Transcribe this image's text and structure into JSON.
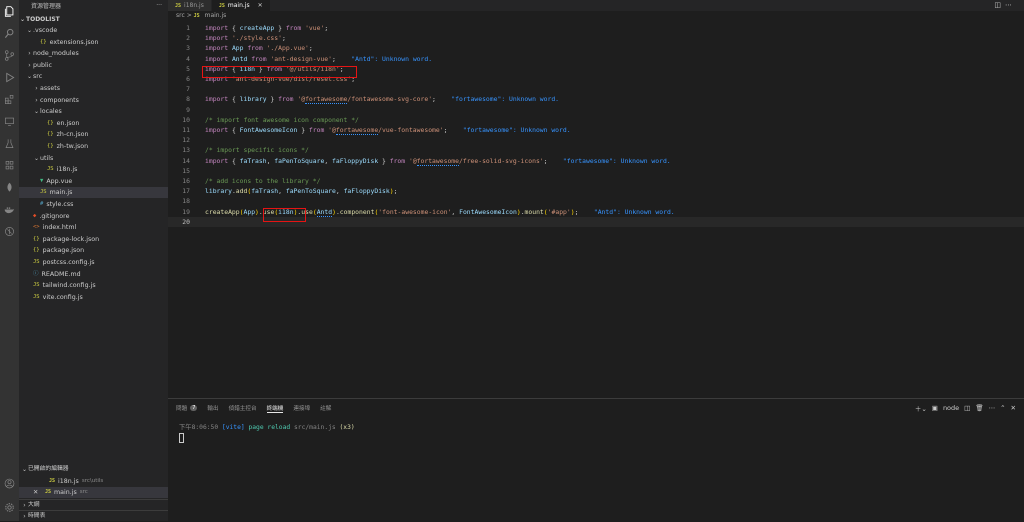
{
  "explorer": {
    "title": "資源管理器",
    "more": "···",
    "folder": "TODOLIST",
    "items": [
      {
        "label": ".vscode",
        "kind": "folder",
        "open": true,
        "depth": 1
      },
      {
        "label": "extensions.json",
        "kind": "json",
        "depth": 2
      },
      {
        "label": "node_modules",
        "kind": "folder",
        "open": false,
        "depth": 1
      },
      {
        "label": "public",
        "kind": "folder",
        "open": false,
        "depth": 1
      },
      {
        "label": "src",
        "kind": "folder",
        "open": true,
        "depth": 1
      },
      {
        "label": "assets",
        "kind": "folder",
        "open": false,
        "depth": 2
      },
      {
        "label": "components",
        "kind": "folder",
        "open": false,
        "depth": 2
      },
      {
        "label": "locales",
        "kind": "folder",
        "open": true,
        "depth": 2
      },
      {
        "label": "en.json",
        "kind": "json",
        "depth": 3
      },
      {
        "label": "zh-cn.json",
        "kind": "json",
        "depth": 3
      },
      {
        "label": "zh-tw.json",
        "kind": "json",
        "depth": 3
      },
      {
        "label": "utils",
        "kind": "folder",
        "open": true,
        "depth": 2
      },
      {
        "label": "i18n.js",
        "kind": "js",
        "depth": 3
      },
      {
        "label": "App.vue",
        "kind": "vue",
        "depth": 2
      },
      {
        "label": "main.js",
        "kind": "js",
        "depth": 2,
        "selected": true
      },
      {
        "label": "style.css",
        "kind": "css",
        "depth": 2
      },
      {
        "label": ".gitignore",
        "kind": "git",
        "depth": 1
      },
      {
        "label": "index.html",
        "kind": "html",
        "depth": 1
      },
      {
        "label": "package-lock.json",
        "kind": "json",
        "depth": 1
      },
      {
        "label": "package.json",
        "kind": "json",
        "depth": 1
      },
      {
        "label": "postcss.config.js",
        "kind": "js",
        "depth": 1
      },
      {
        "label": "README.md",
        "kind": "md",
        "depth": 1
      },
      {
        "label": "tailwind.config.js",
        "kind": "js",
        "depth": 1
      },
      {
        "label": "vite.config.js",
        "kind": "js",
        "depth": 1
      }
    ],
    "open_editors": {
      "title": "已開啟的編輯器",
      "files": [
        {
          "name": "i18n.js",
          "path": "src\\utils",
          "active": false
        },
        {
          "name": "main.js",
          "path": "src",
          "active": true
        }
      ]
    },
    "outline": "大綱",
    "timeline": "時間表"
  },
  "tabs": [
    {
      "label": "i18n.js",
      "active": false
    },
    {
      "label": "main.js",
      "active": true
    }
  ],
  "breadcrumb": {
    "folder": "src",
    "sep": ">",
    "file": "main.js"
  },
  "code_lines": [
    [
      [
        "k",
        "import"
      ],
      [
        "p",
        " { "
      ],
      [
        "v",
        "createApp"
      ],
      [
        "p",
        " } "
      ],
      [
        "k",
        "from"
      ],
      [
        "s",
        " 'vue'"
      ],
      [
        "p",
        ";"
      ]
    ],
    [
      [
        "k",
        "import"
      ],
      [
        "s",
        " './style.css'"
      ],
      [
        "p",
        ";"
      ]
    ],
    [
      [
        "k",
        "import"
      ],
      [
        "v",
        " App"
      ],
      [
        "k",
        " from"
      ],
      [
        "s",
        " './App.vue'"
      ],
      [
        "p",
        ";"
      ]
    ],
    [
      [
        "k",
        "import"
      ],
      [
        "v",
        " Antd"
      ],
      [
        "k",
        " from"
      ],
      [
        "s",
        " 'ant-design-vue'"
      ],
      [
        "p",
        ";"
      ],
      [
        "hint",
        "    \"Antd\": Unknown word."
      ]
    ],
    [
      [
        "k",
        "import"
      ],
      [
        "p",
        " { "
      ],
      [
        "v",
        "i18n"
      ],
      [
        "p",
        " } "
      ],
      [
        "k",
        "from"
      ],
      [
        "s",
        " '@/utils/i18n'"
      ],
      [
        "p",
        ";"
      ]
    ],
    [
      [
        "k",
        "import"
      ],
      [
        "s",
        " 'ant-design-vue/dist/reset.css'"
      ],
      [
        "p",
        ";"
      ]
    ],
    [],
    [
      [
        "k",
        "import"
      ],
      [
        "p",
        " { "
      ],
      [
        "v",
        "library"
      ],
      [
        "p",
        " } "
      ],
      [
        "k",
        "from"
      ],
      [
        "s",
        " '@"
      ],
      [
        "sul",
        "fortawesome"
      ],
      [
        "s",
        "/fontawesome-svg-core'"
      ],
      [
        "p",
        ";"
      ],
      [
        "hint",
        "    \"fortawesome\": Unknown word."
      ]
    ],
    [],
    [
      [
        "c",
        "/* import font awesome icon component */"
      ]
    ],
    [
      [
        "k",
        "import"
      ],
      [
        "p",
        " { "
      ],
      [
        "v",
        "FontAwesomeIcon"
      ],
      [
        "p",
        " } "
      ],
      [
        "k",
        "from"
      ],
      [
        "s",
        " '@"
      ],
      [
        "sul",
        "fortawesome"
      ],
      [
        "s",
        "/vue-fontawesome'"
      ],
      [
        "p",
        ";"
      ],
      [
        "hint",
        "    \"fortawesome\": Unknown word."
      ]
    ],
    [],
    [
      [
        "c",
        "/* import specific icons */"
      ]
    ],
    [
      [
        "k",
        "import"
      ],
      [
        "p",
        " { "
      ],
      [
        "v",
        "faTrash"
      ],
      [
        "p",
        ", "
      ],
      [
        "v",
        "faPenToSquare"
      ],
      [
        "p",
        ", "
      ],
      [
        "v",
        "faFloppyDisk"
      ],
      [
        "p",
        " } "
      ],
      [
        "k",
        "from"
      ],
      [
        "s",
        " '@"
      ],
      [
        "sul",
        "fortawesome"
      ],
      [
        "s",
        "/free-solid-svg-icons'"
      ],
      [
        "p",
        ";"
      ],
      [
        "hint",
        "    \"fortawesome\": Unknown word."
      ]
    ],
    [],
    [
      [
        "c",
        "/* add icons to the library */"
      ]
    ],
    [
      [
        "v",
        "library"
      ],
      [
        "p",
        "."
      ],
      [
        "f",
        "add"
      ],
      [
        "b",
        "("
      ],
      [
        "v",
        "faTrash"
      ],
      [
        "p",
        ", "
      ],
      [
        "v",
        "faPenToSquare"
      ],
      [
        "p",
        ", "
      ],
      [
        "v",
        "faFloppyDisk"
      ],
      [
        "b",
        ")"
      ],
      [
        "p",
        ";"
      ]
    ],
    [],
    [
      [
        "f",
        "createApp"
      ],
      [
        "b",
        "("
      ],
      [
        "v",
        "App"
      ],
      [
        "b",
        ")"
      ],
      [
        "p",
        "."
      ],
      [
        "f",
        "use"
      ],
      [
        "b",
        "("
      ],
      [
        "v",
        "i18n"
      ],
      [
        "b",
        ")"
      ],
      [
        "p",
        "."
      ],
      [
        "f",
        "use"
      ],
      [
        "b",
        "("
      ],
      [
        "vul",
        "Antd"
      ],
      [
        "b",
        ")"
      ],
      [
        "p",
        "."
      ],
      [
        "f",
        "component"
      ],
      [
        "b",
        "("
      ],
      [
        "s",
        "'font-awesome-icon'"
      ],
      [
        "p",
        ", "
      ],
      [
        "v",
        "FontAwesomeIcon"
      ],
      [
        "b",
        ")"
      ],
      [
        "p",
        "."
      ],
      [
        "f",
        "mount"
      ],
      [
        "b",
        "("
      ],
      [
        "s",
        "'#app'"
      ],
      [
        "b",
        ")"
      ],
      [
        "p",
        ";"
      ],
      [
        "hint",
        "    \"Antd\": Unknown word."
      ]
    ],
    []
  ],
  "panel": {
    "tabs": [
      {
        "label": "問題",
        "badge": "7"
      },
      {
        "label": "輸出"
      },
      {
        "label": "偵錯主控台"
      },
      {
        "label": "終端機",
        "active": true
      },
      {
        "label": "連接埠"
      },
      {
        "label": "註解"
      }
    ],
    "terminal_name": "node",
    "terminal_lines": [
      [
        [
          "#858585",
          "下午8:06:50 "
        ],
        [
          "#3794ff",
          "[vite]"
        ],
        [
          "#4ec9b0",
          " page reload "
        ],
        [
          "#858585",
          "src/main.js "
        ],
        [
          "#dcdcaa",
          "(x3)"
        ]
      ]
    ]
  }
}
